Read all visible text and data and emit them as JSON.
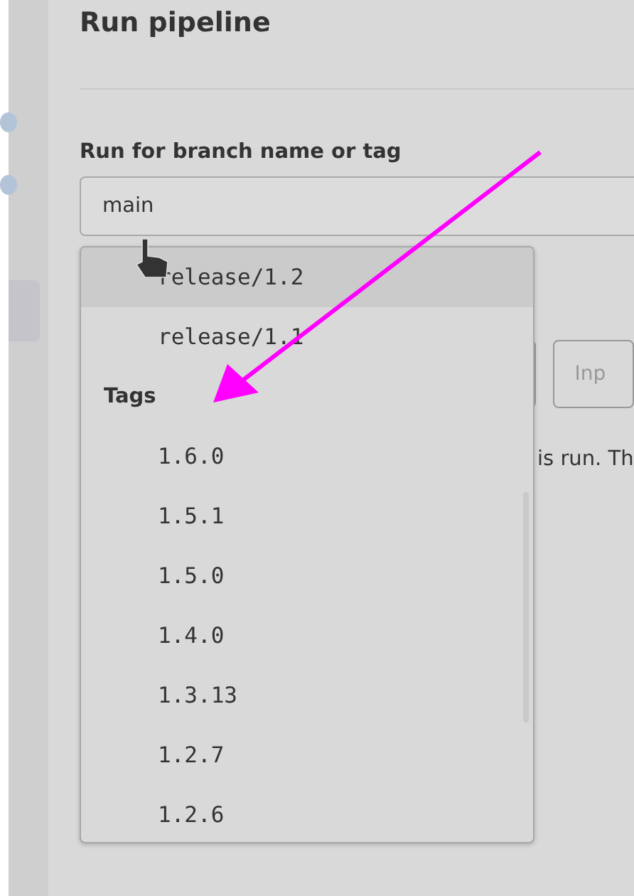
{
  "page": {
    "title": "Run pipeline"
  },
  "branch_field": {
    "label": "Run for branch name or tag",
    "value": "main"
  },
  "dropdown": {
    "items": [
      {
        "kind": "option",
        "text": "release/1.2",
        "selected": true
      },
      {
        "kind": "option",
        "text": "release/1.1",
        "selected": false
      },
      {
        "kind": "header",
        "text": "Tags"
      },
      {
        "kind": "option",
        "text": "1.6.0",
        "selected": false
      },
      {
        "kind": "option",
        "text": "1.5.1",
        "selected": false
      },
      {
        "kind": "option",
        "text": "1.5.0",
        "selected": false
      },
      {
        "kind": "option",
        "text": "1.4.0",
        "selected": false
      },
      {
        "kind": "option",
        "text": "1.3.13",
        "selected": false
      },
      {
        "kind": "option",
        "text": "1.2.7",
        "selected": false
      },
      {
        "kind": "option",
        "text": "1.2.6",
        "selected": false
      }
    ]
  },
  "variable_row": {
    "input_placeholder": "Inp",
    "help_text": "is run. Th"
  }
}
